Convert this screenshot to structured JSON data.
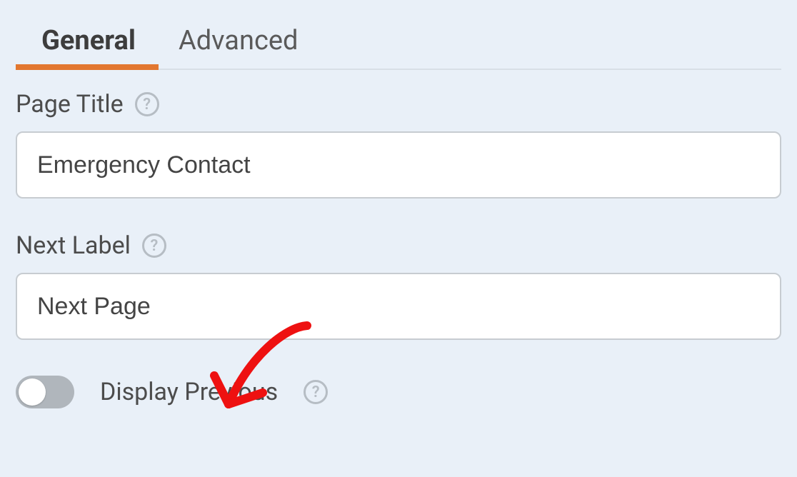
{
  "tabs": {
    "general": "General",
    "advanced": "Advanced"
  },
  "fields": {
    "page_title": {
      "label": "Page Title",
      "value": "Emergency Contact"
    },
    "next_label": {
      "label": "Next Label",
      "value": "Next Page"
    },
    "display_previous": {
      "label": "Display Previous",
      "on": false
    }
  },
  "help_glyph": "?"
}
